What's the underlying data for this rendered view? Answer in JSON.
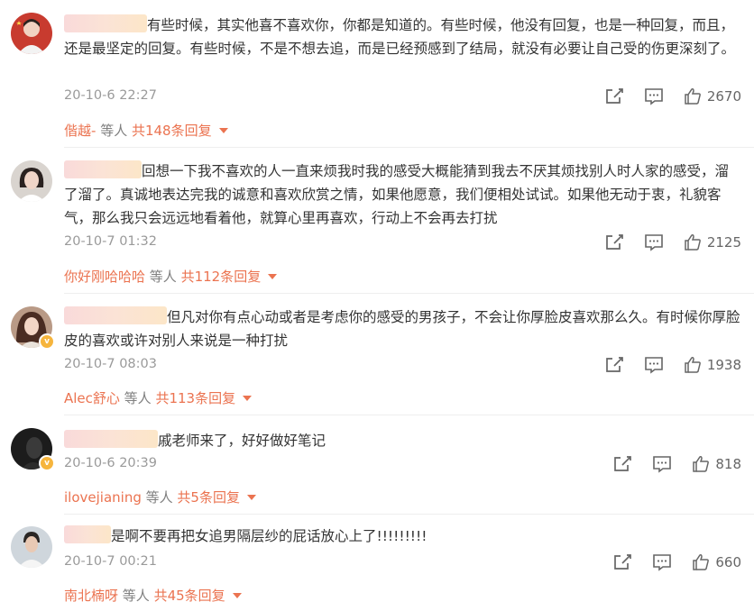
{
  "comments": [
    {
      "text": "有些时候，其实他喜不喜欢你，你都是知道的。有些时候，他没有回复，也是一种回复，而且，还是最坚定的回复。有些时候，不是不想去追，而是已经预感到了结局，就没有必要让自己受的伤更深刻了。",
      "time": "20-10-6 22:27",
      "likes": "2670",
      "reply_user": "偕越-",
      "reply_mid": " 等人 ",
      "reply_count": "共148条回复"
    },
    {
      "text": "回想一下我不喜欢的人一直来烦我时我的感受大概能猜到我去不厌其烦找别人时人家的感受，溜了溜了。真诚地表达完我的诚意和喜欢欣赏之情，如果他愿意，我们便相处试试。如果他无动于衷，礼貌客气，那么我只会远远地看着他，就算心里再喜欢，行动上不会再去打扰",
      "time": "20-10-7 01:32",
      "likes": "2125",
      "reply_user": "你好刚哈哈哈",
      "reply_mid": " 等人 ",
      "reply_count": "共112条回复"
    },
    {
      "text": "但凡对你有点心动或者是考虑你的感受的男孩子，不会让你厚脸皮喜欢那么久。有时候你厚脸皮的喜欢或许对别人来说是一种打扰",
      "time": "20-10-7 08:03",
      "likes": "1938",
      "reply_user": "Alec舒心",
      "reply_mid": " 等人 ",
      "reply_count": "共113条回复"
    },
    {
      "text": "戚老师来了，好好做好笔记",
      "time": "20-10-6 20:39",
      "likes": "818",
      "reply_user": "ilovejianing",
      "reply_mid": " 等人 ",
      "reply_count": "共5条回复"
    },
    {
      "text": "是啊不要再把女追男隔层纱的屁话放心上了!!!!!!!!!",
      "time": "20-10-7 00:21",
      "likes": "660",
      "reply_user": "南北楠呀",
      "reply_mid": " 等人 ",
      "reply_count": "共45条回复"
    }
  ],
  "icons": {
    "share": "share-icon",
    "comment": "comment-icon",
    "like": "thumbs-up-icon",
    "verified": "verified-badge-icon"
  },
  "colors": {
    "accent": "#eb7350",
    "time": "#9a9a9a",
    "text": "#333333",
    "badge": "#f6b53d"
  }
}
